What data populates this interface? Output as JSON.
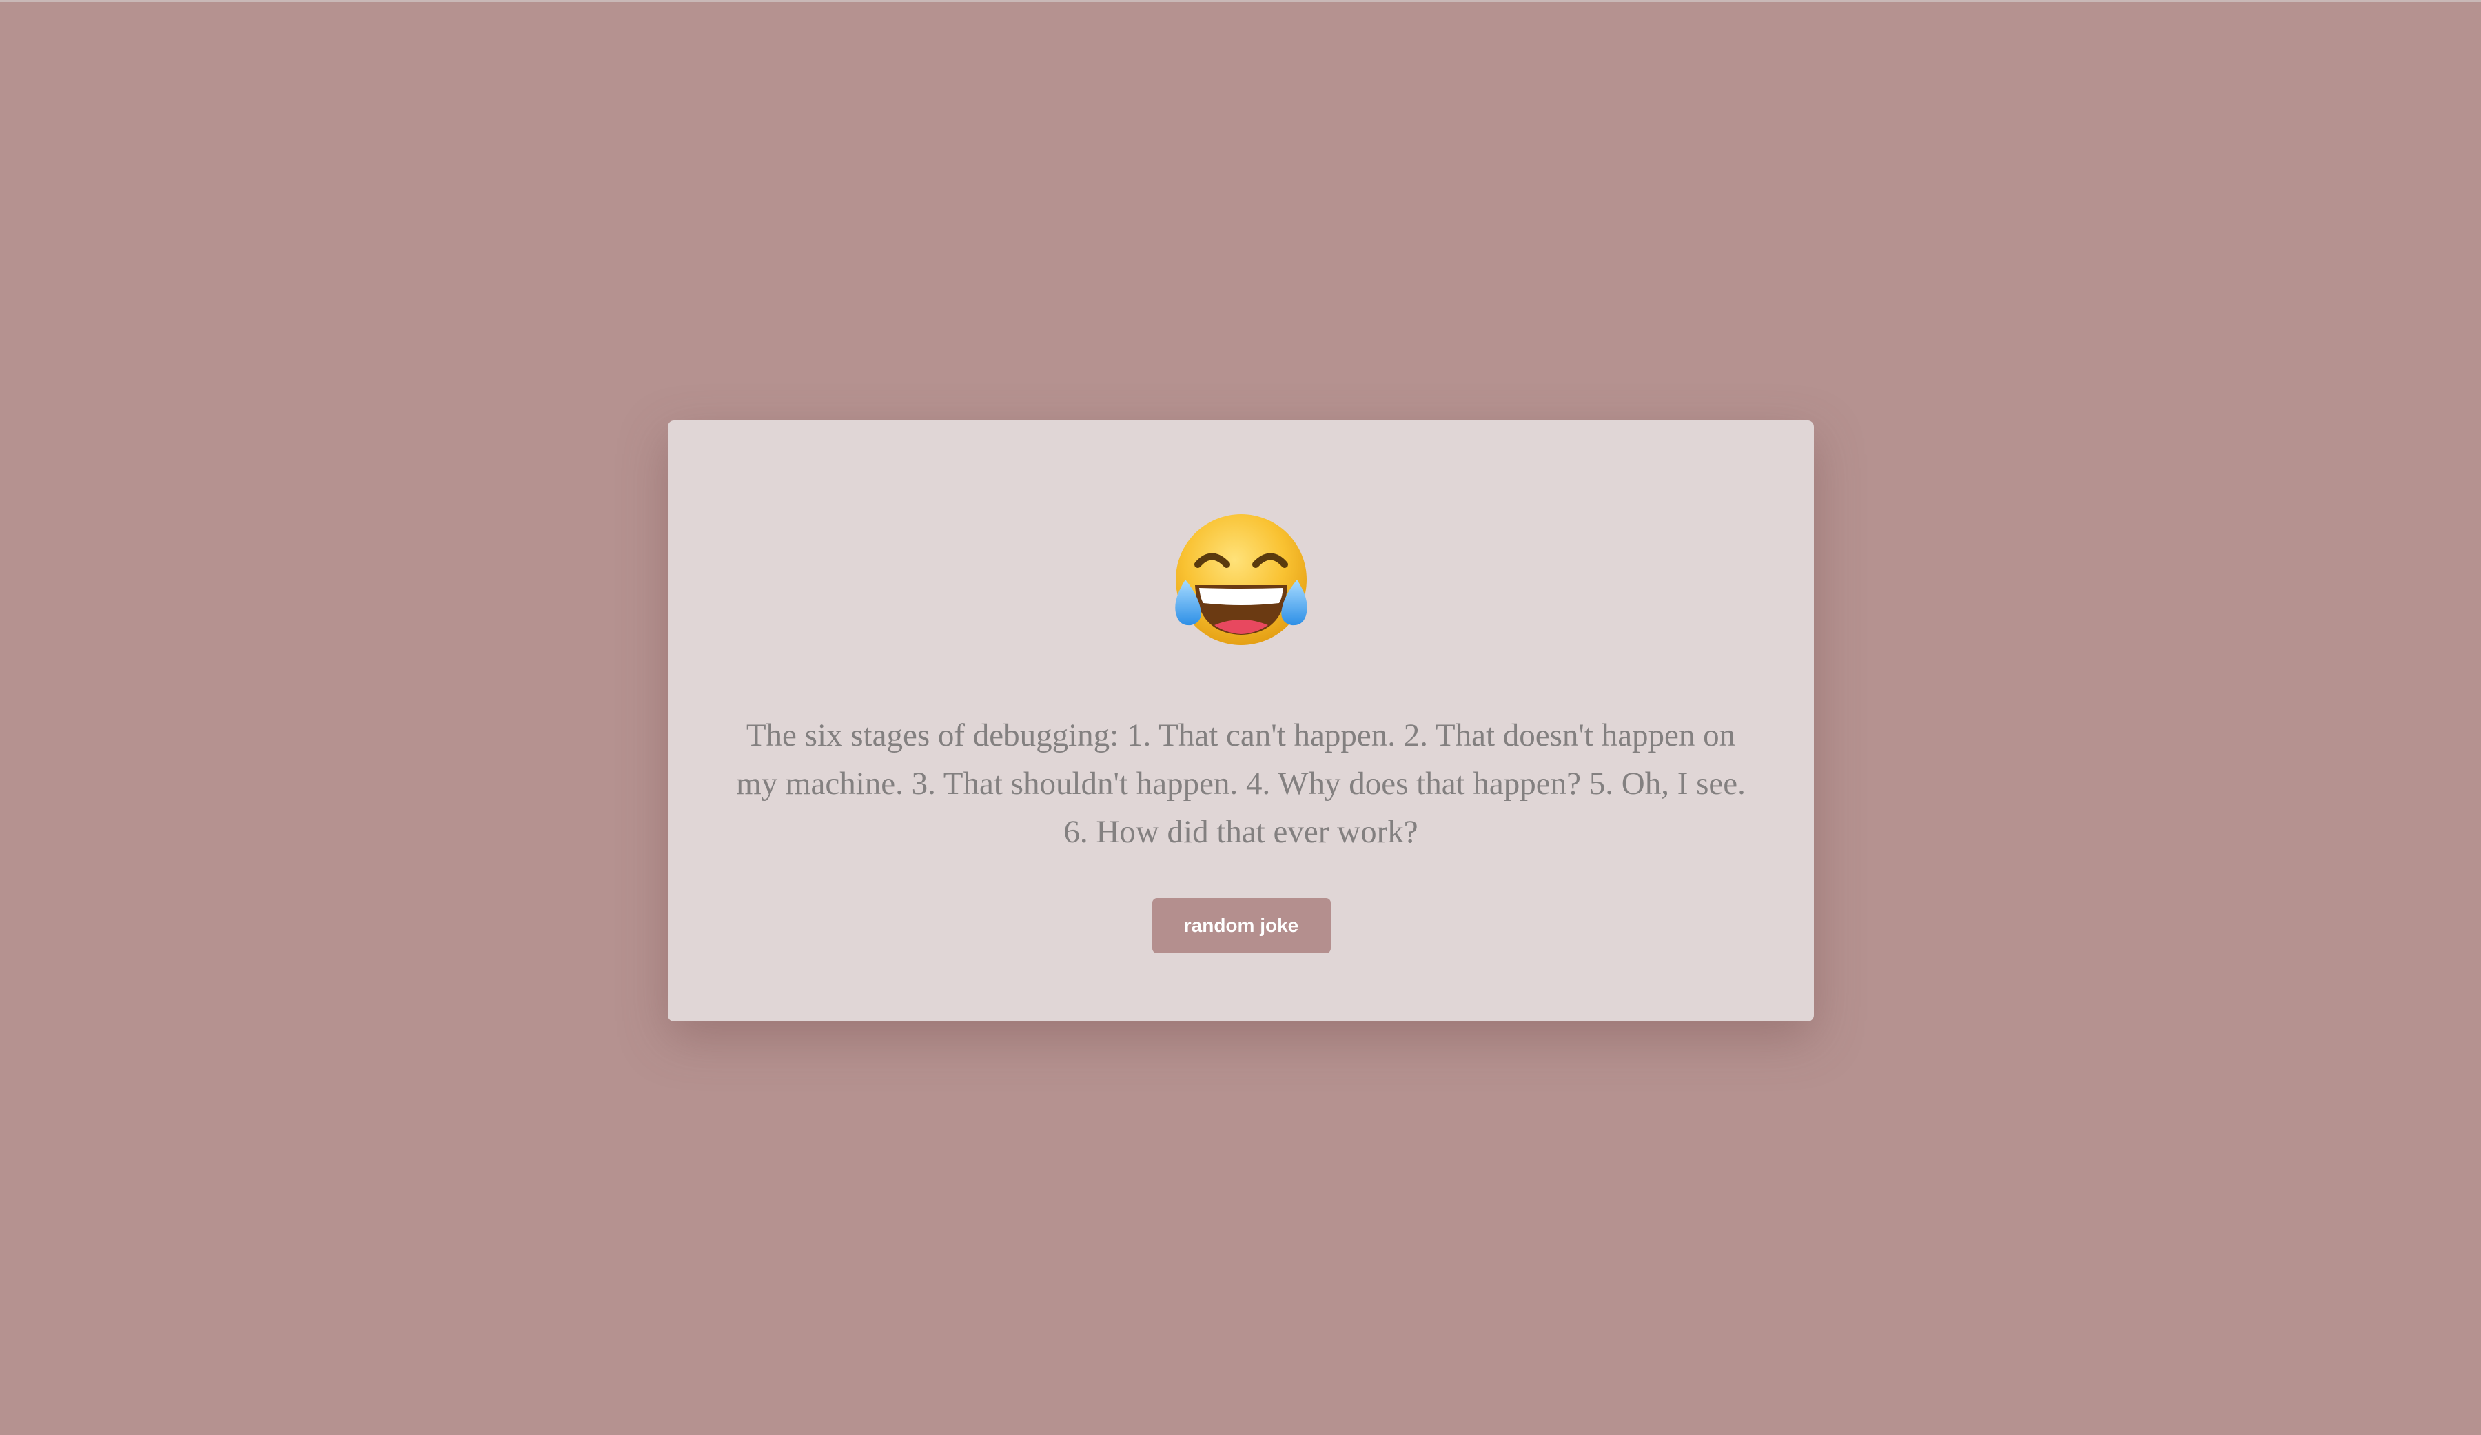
{
  "card": {
    "emoji_icon": "face-with-tears-of-joy-icon",
    "joke_text": "The six stages of debugging: 1. That can't happen. 2. That doesn't happen on my machine. 3. That shouldn't happen. 4. Why does that happen? 5. Oh, I see. 6. How did that ever work?",
    "button_label": "random joke"
  },
  "colors": {
    "page_background": "#b59290",
    "card_background": "#e0d6d6",
    "text": "#838080",
    "button_background": "#b48f8e",
    "button_text": "#ffffff"
  }
}
